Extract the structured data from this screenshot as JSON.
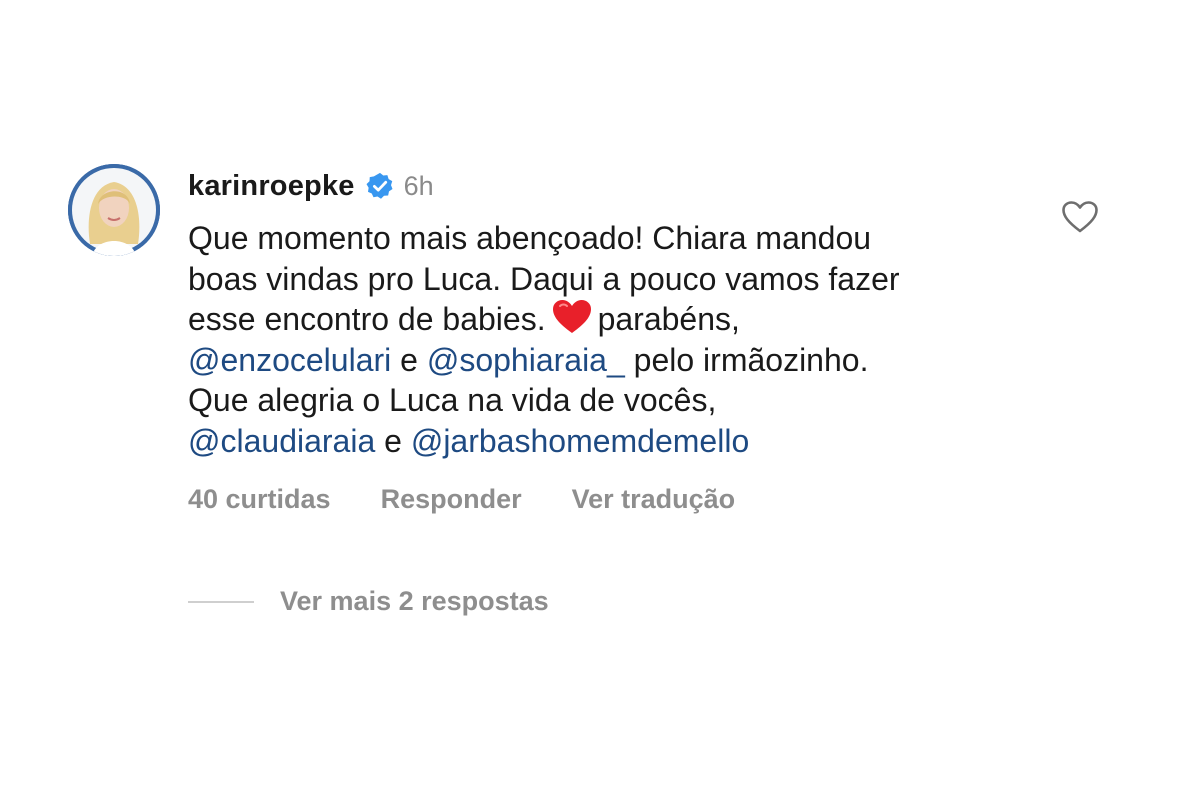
{
  "comment": {
    "username": "karinroepke",
    "time": "6h",
    "verified_icon": "verified-badge-icon",
    "avatar_icon": "avatar-photo",
    "text": {
      "line1": "Que momento mais abençoado! Chiara mandou",
      "line2": "boas vindas pro Luca. Daqui a pouco vamos fazer",
      "line3_a": "esse encontro de babies.",
      "line3_b": "parabéns,",
      "mention1": "@enzocelulari",
      "conj1": "e",
      "mention2": "@sophiaraia_",
      "line4_end": "pelo irmãozinho.",
      "line5": "Que alegria o Luca na vida de vocês,",
      "mention3": "@claudiaraia",
      "conj2": "e",
      "mention4": "@jarbashomemdemello"
    },
    "emoji": "red-heart-emoji"
  },
  "actions": {
    "likes": "40 curtidas",
    "reply": "Responder",
    "translate": "Ver tradução"
  },
  "replies": {
    "label": "Ver mais 2 respostas"
  },
  "colors": {
    "text": "#1a1a1a",
    "secondary": "#8e8e8e",
    "mention": "#1e4a82",
    "verified": "#3897f0",
    "emoji_heart": "#e8202a"
  }
}
